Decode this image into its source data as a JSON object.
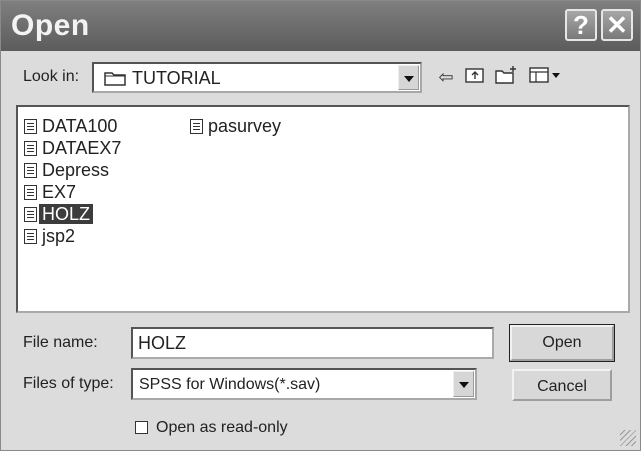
{
  "window": {
    "title": "Open",
    "help_icon": "help-icon",
    "close_icon": "close-icon"
  },
  "lookin": {
    "label": "Look in:",
    "value": "TUTORIAL",
    "folder_icon": "folder-icon"
  },
  "toolbar": {
    "back": "back-icon",
    "up": "up-folder-icon",
    "new_folder": "new-folder-icon",
    "views": "views-menu-icon"
  },
  "files": {
    "col1": [
      "DATA100",
      "DATAEX7",
      "Depress",
      "EX7",
      "HOLZ",
      "jsp2"
    ],
    "col2": [
      "pasurvey"
    ],
    "selected": "HOLZ"
  },
  "filename": {
    "label": "File name:",
    "value": "HOLZ"
  },
  "filetype": {
    "label": "Files of type:",
    "value": "SPSS for Windows(*.sav)"
  },
  "buttons": {
    "open": "Open",
    "cancel": "Cancel"
  },
  "readonly": {
    "label": "Open as read-only",
    "checked": false
  }
}
